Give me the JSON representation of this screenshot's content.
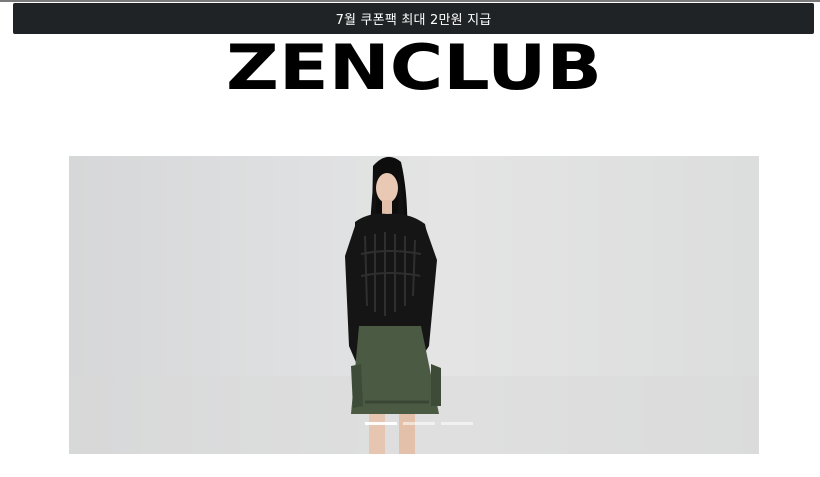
{
  "promo": {
    "text": "7월 쿠폰팩 최대 2만원 지급"
  },
  "header": {
    "logo_text": "ZENCLUB"
  },
  "hero": {
    "slide_count": 3,
    "active_slide": 1
  },
  "colors": {
    "promo_bg": "#1f2326",
    "logo": "#000000",
    "page_bg": "#ffffff"
  }
}
